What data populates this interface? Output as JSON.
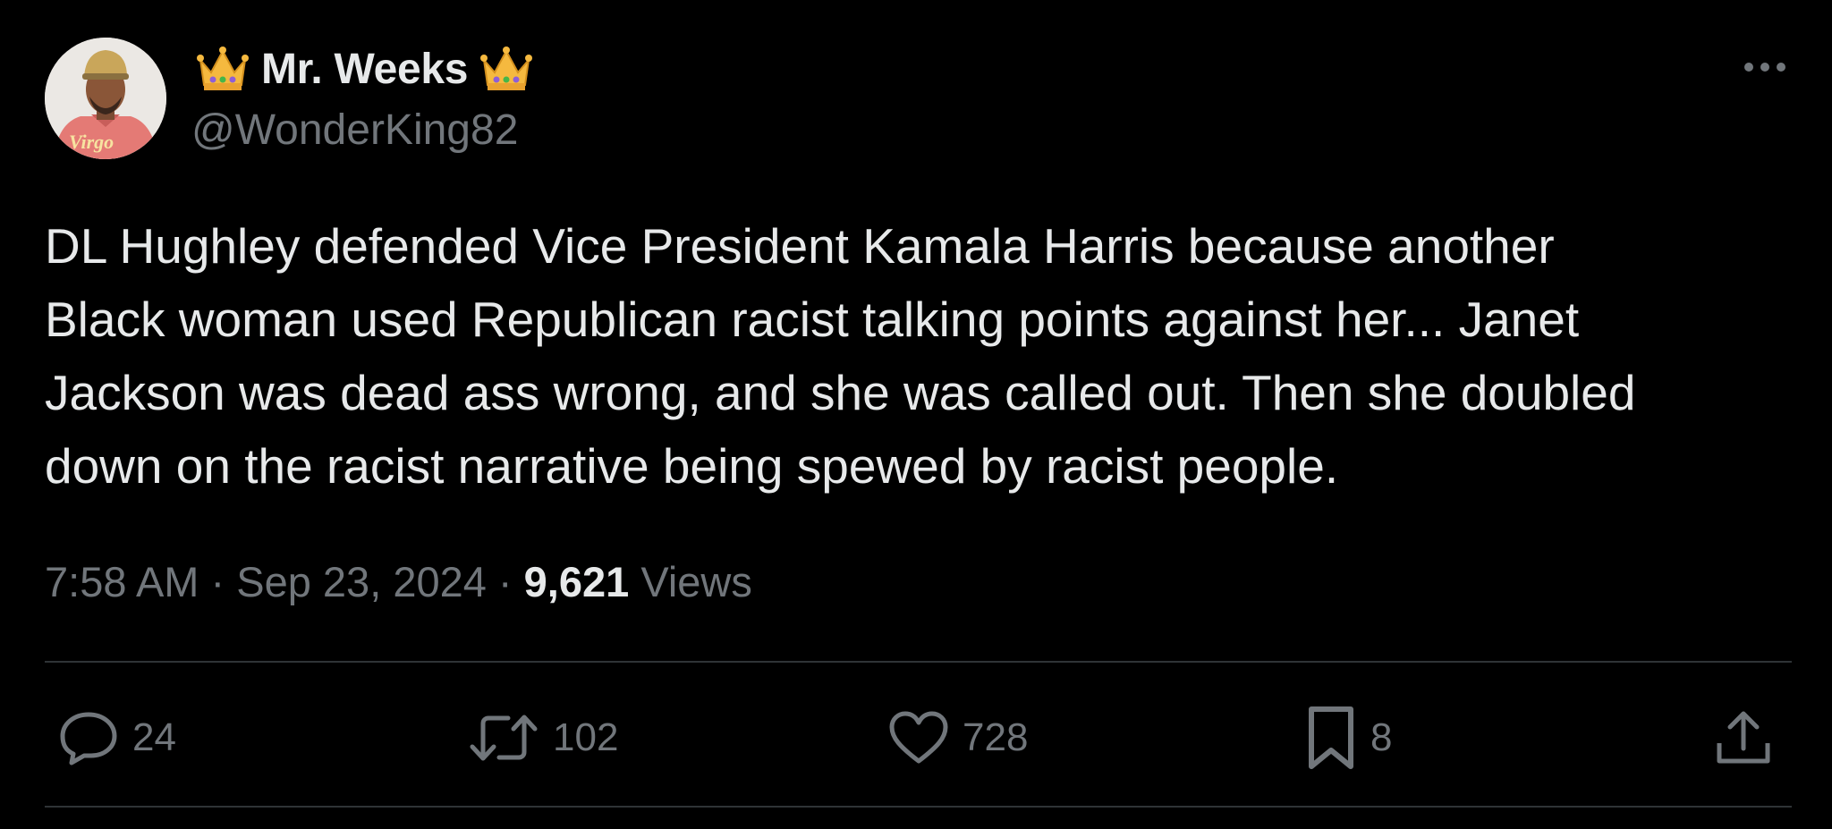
{
  "author": {
    "display_name": "Mr. Weeks",
    "handle": "@WonderKing82",
    "badge_icon": "crown-emoji",
    "avatar_shirt_text": "Virgo"
  },
  "tweet": {
    "text": "DL Hughley defended Vice President Kamala Harris because another\nBlack woman used Republican racist talking points against her... Janet\nJackson was dead ass wrong, and she was called out. Then she doubled\ndown on the racist narrative being spewed by racist people.",
    "time": "7:58 AM",
    "date": "Sep 23, 2024",
    "separator": " · ",
    "views_count": "9,621",
    "views_label": "Views"
  },
  "actions": {
    "replies": "24",
    "reposts": "102",
    "likes": "728",
    "bookmarks": "8"
  },
  "colors": {
    "background": "#000000",
    "primary_text": "#e7e9ea",
    "secondary_text": "#71767b",
    "divider": "#2f3336"
  }
}
